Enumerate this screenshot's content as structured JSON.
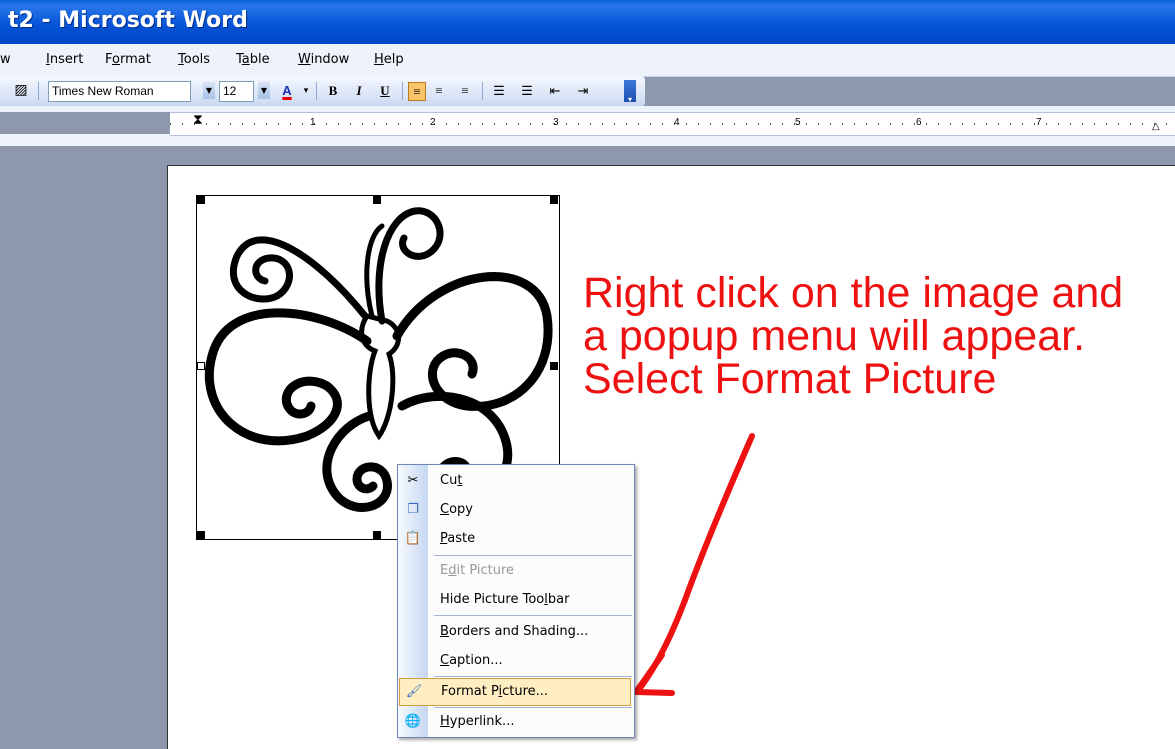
{
  "app": {
    "title": "t2 - Microsoft Word"
  },
  "menu": {
    "items": [
      {
        "pre": "",
        "u": "",
        "post": "w"
      },
      {
        "pre": "",
        "u": "I",
        "post": "nsert"
      },
      {
        "pre": "F",
        "u": "o",
        "post": "rmat"
      },
      {
        "pre": "",
        "u": "T",
        "post": "ools"
      },
      {
        "pre": "T",
        "u": "a",
        "post": "ble"
      },
      {
        "pre": "",
        "u": "W",
        "post": "indow"
      },
      {
        "pre": "",
        "u": "H",
        "post": "elp"
      }
    ]
  },
  "toolbar": {
    "font_name": "Times New Roman",
    "font_size": "12",
    "font_color_glyph": "A",
    "bold": "B",
    "italic": "I",
    "underline": "U"
  },
  "ruler": {
    "numbers": [
      "1",
      "2",
      "3",
      "4",
      "5",
      "6",
      "7"
    ]
  },
  "annotation": {
    "line1": "Right click on the image and",
    "line2": "a popup menu will appear.",
    "line3": "Select Format Picture",
    "color": "#ee1111"
  },
  "context_menu": {
    "cut": {
      "pre": "Cu",
      "u": "t",
      "post": "",
      "icon": "scissors-icon"
    },
    "copy": {
      "pre": "",
      "u": "C",
      "post": "opy",
      "icon": "copy-icon"
    },
    "paste": {
      "pre": "",
      "u": "P",
      "post": "aste",
      "icon": "paste-icon"
    },
    "edit_picture": {
      "pre": "E",
      "u": "d",
      "post": "it Picture"
    },
    "hide_toolbar": {
      "pre": "Hide Picture Too",
      "u": "l",
      "post": "bar"
    },
    "borders": {
      "pre": "",
      "u": "B",
      "post": "orders and Shading..."
    },
    "caption": {
      "pre": "",
      "u": "C",
      "post": "aption..."
    },
    "format_picture": {
      "pre": "Format P",
      "u": "i",
      "post": "cture...",
      "icon": "format-picture-icon",
      "highlight": "#ffeec2"
    },
    "hyperlink": {
      "pre": "",
      "u": "H",
      "post": "yperlink...",
      "icon": "hyperlink-icon"
    }
  },
  "colors": {
    "titlebar": "#0654d8",
    "workspace": "#8e98ac",
    "annotation": "#ee1111"
  }
}
